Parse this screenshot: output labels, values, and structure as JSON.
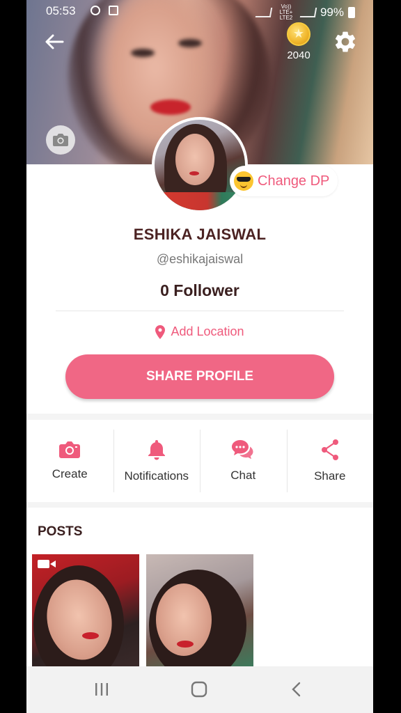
{
  "status_bar": {
    "time": "05:53",
    "carrier": "Vo)) LTE+ LTE2",
    "battery": "99%"
  },
  "header": {
    "coin_count": "2040"
  },
  "profile": {
    "change_dp_label": "Change DP",
    "name": "ESHIKA JAISWAL",
    "handle": "@eshikajaiswal",
    "followers": "0 Follower",
    "location_label": "Add Location",
    "share_button": "SHARE PROFILE"
  },
  "actions": [
    {
      "label": "Create",
      "icon": "camera-icon"
    },
    {
      "label": "Notifications",
      "icon": "bell-icon"
    },
    {
      "label": "Chat",
      "icon": "chat-bubbles-icon"
    },
    {
      "label": "Share",
      "icon": "share-icon"
    }
  ],
  "posts": {
    "title": "POSTS"
  },
  "colors": {
    "accent": "#f06785",
    "accent_text": "#ef5a7c",
    "icon": "#ef5a7c",
    "title_text": "#4b2222"
  }
}
